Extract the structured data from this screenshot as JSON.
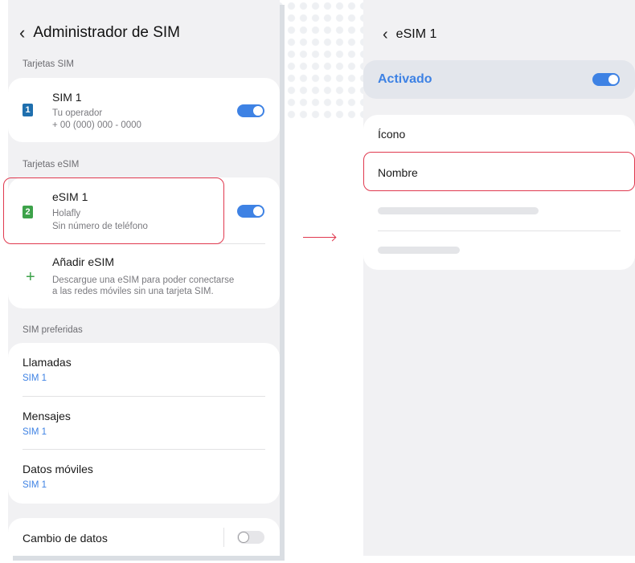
{
  "left": {
    "title": "Administrador de SIM",
    "sim_section_label": "Tarjetas SIM",
    "sim1": {
      "badge": "1",
      "title": "SIM 1",
      "operator": "Tu operador",
      "number": "+ 00 (000) 000 - 0000",
      "enabled": true
    },
    "esim_section_label": "Tarjetas eSIM",
    "esim1": {
      "badge": "2",
      "title": "eSIM 1",
      "operator": "Holafly",
      "number": "Sin número de teléfono",
      "enabled": true
    },
    "add_esim": {
      "title": "Añadir eSIM",
      "description_line1": "Descargue una eSIM para poder conectarse",
      "description_line2": "a las redes móviles sin una tarjeta SIM."
    },
    "preferred_label": "SIM preferidas",
    "preferred": [
      {
        "title": "Llamadas",
        "value": "SIM 1"
      },
      {
        "title": "Mensajes",
        "value": "SIM 1"
      },
      {
        "title": "Datos móviles",
        "value": "SIM 1"
      }
    ],
    "data_switch": {
      "title": "Cambio de datos",
      "enabled": false
    }
  },
  "right": {
    "title": "eSIM 1",
    "activated_label": "Activado",
    "activated": true,
    "items": [
      {
        "title": "Ícono"
      },
      {
        "title": "Nombre"
      }
    ]
  },
  "colors": {
    "accent": "#3e82e4",
    "highlight": "#e0394f",
    "green": "#3da24a",
    "badge_blue": "#1f6fae"
  },
  "icons": {
    "back": "chevron-left-icon",
    "add": "plus-icon"
  }
}
